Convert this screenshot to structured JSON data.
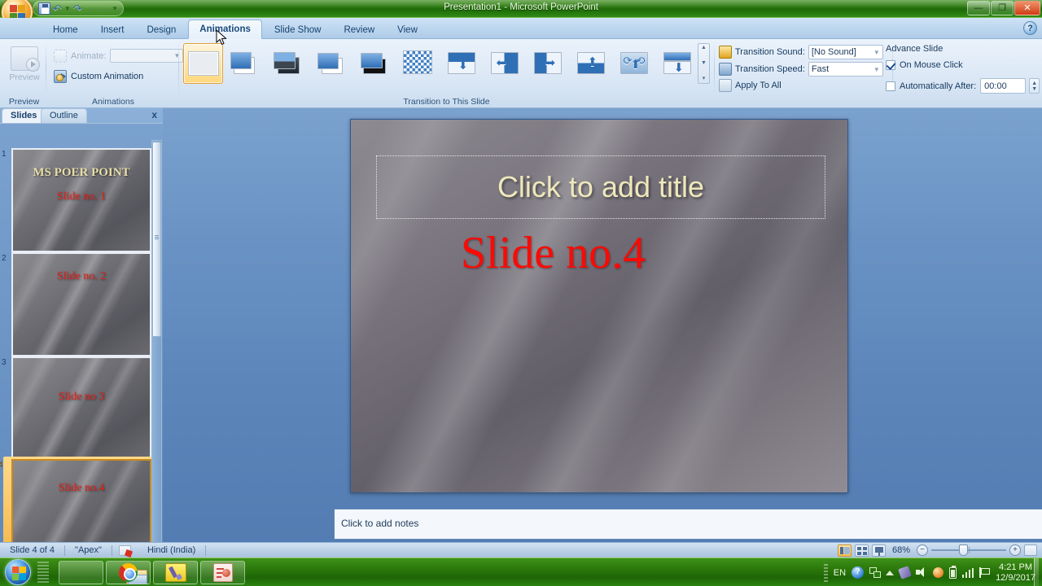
{
  "window": {
    "title": "Presentation1 - Microsoft PowerPoint",
    "minimize_label": "—",
    "restore_label": "❐",
    "close_label": "✕",
    "office_button_name": "Office Button",
    "help_label": "?"
  },
  "quick_access": {
    "items": [
      {
        "name": "save-icon",
        "label": "Save"
      },
      {
        "name": "undo-icon",
        "label": "Undo"
      },
      {
        "name": "undo-dropdown-icon",
        "label": "▾"
      },
      {
        "name": "redo-icon",
        "label": "Redo"
      },
      {
        "name": "customize-qat-icon",
        "label": "▾"
      }
    ]
  },
  "ribbon": {
    "tabs": [
      {
        "label": "Home",
        "active": false
      },
      {
        "label": "Insert",
        "active": false
      },
      {
        "label": "Design",
        "active": false
      },
      {
        "label": "Animations",
        "active": true
      },
      {
        "label": "Slide Show",
        "active": false
      },
      {
        "label": "Review",
        "active": false
      },
      {
        "label": "View",
        "active": false
      }
    ],
    "groups": {
      "preview": {
        "label": "Preview",
        "button_label": "Preview"
      },
      "animations": {
        "label": "Animations",
        "animate_label": "Animate:",
        "animate_value": "",
        "animate_placeholder": "",
        "custom_animation_label": "Custom Animation"
      },
      "transition": {
        "label": "Transition to This Slide",
        "items": [
          {
            "name": "no-transition",
            "title": "No Transition",
            "selected": true
          },
          {
            "name": "blinds-fade-smoothly",
            "title": "Fade Smoothly",
            "selected": false
          },
          {
            "name": "fade-through-black",
            "title": "Fade Through Black",
            "selected": false
          },
          {
            "name": "cut",
            "title": "Cut",
            "selected": false
          },
          {
            "name": "cut-through-black",
            "title": "Cut Through Black",
            "selected": false
          },
          {
            "name": "dissolve",
            "title": "Dissolve",
            "selected": false
          },
          {
            "name": "wipe-down",
            "title": "Wipe Down",
            "selected": false
          },
          {
            "name": "wipe-left",
            "title": "Wipe Left",
            "selected": false
          },
          {
            "name": "wipe-right",
            "title": "Wipe Right",
            "selected": false
          },
          {
            "name": "wipe-up",
            "title": "Wipe Up",
            "selected": false
          },
          {
            "name": "wedge",
            "title": "Wedge",
            "selected": false
          },
          {
            "name": "push-down",
            "title": "Push Down",
            "selected": false
          }
        ],
        "scroll_up": "▲",
        "scroll_down": "▼",
        "scroll_more": "▾"
      },
      "options": {
        "transition_sound_label": "Transition Sound:",
        "transition_sound_value": "[No Sound]",
        "transition_speed_label": "Transition Speed:",
        "transition_speed_value": "Fast",
        "apply_to_all_label": "Apply To All"
      },
      "advance": {
        "title": "Advance Slide",
        "on_mouse_click_label": "On Mouse Click",
        "on_mouse_click_checked": true,
        "automatically_after_label": "Automatically After:",
        "automatically_after_checked": false,
        "automatically_after_value": "00:00"
      }
    }
  },
  "slides_pane": {
    "tab_slides": "Slides",
    "tab_outline": "Outline",
    "close_label": "x",
    "slides": [
      {
        "number": "1",
        "title": "MS POER POINT",
        "subtitle": "Slide no. 1",
        "selected": false
      },
      {
        "number": "2",
        "title": "",
        "subtitle": "Slide no. 2",
        "selected": false
      },
      {
        "number": "3",
        "title": "",
        "subtitle": "Slide no 3",
        "selected": false
      },
      {
        "number": "4",
        "title": "",
        "subtitle": "Slide no.4",
        "selected": true
      }
    ],
    "scroll_down_label": "▼"
  },
  "slide_canvas": {
    "title_placeholder": "Click to add title",
    "body_text": "Slide no.4"
  },
  "notes_pane": {
    "placeholder": "Click to add notes"
  },
  "status_bar": {
    "slide_counter": "Slide 4 of 4",
    "theme": "\"Apex\"",
    "spelling_icon_name": "spelling-check-icon",
    "language": "Hindi (India)",
    "views": [
      {
        "name": "normal-view",
        "label": "Normal",
        "active": true
      },
      {
        "name": "slide-sorter-view",
        "label": "Slide Sorter",
        "active": false
      },
      {
        "name": "slide-show-view",
        "label": "Slide Show",
        "active": false
      }
    ],
    "zoom_out_label": "−",
    "zoom_in_label": "+",
    "zoom_level": "68%",
    "fit_label": "Fit slide to current window"
  },
  "taskbar": {
    "start_label": "Start",
    "buttons": [
      {
        "name": "taskbar-explorer",
        "label": "Windows Explorer"
      },
      {
        "name": "taskbar-chrome",
        "label": "Google Chrome"
      },
      {
        "name": "taskbar-paint",
        "label": "Paint"
      },
      {
        "name": "taskbar-powerpoint",
        "label": "Microsoft PowerPoint"
      }
    ],
    "tray": {
      "language": "EN",
      "help_label": "?",
      "time": "4:21 PM",
      "date": "12/9/2017"
    }
  },
  "colors": {
    "accent_orange": "#f3b444",
    "office_green": "#2e7d12",
    "slide_red": "#fb0a05",
    "title_gold": "#eee8bb",
    "ribbon_blue": "#d3e2f2"
  }
}
